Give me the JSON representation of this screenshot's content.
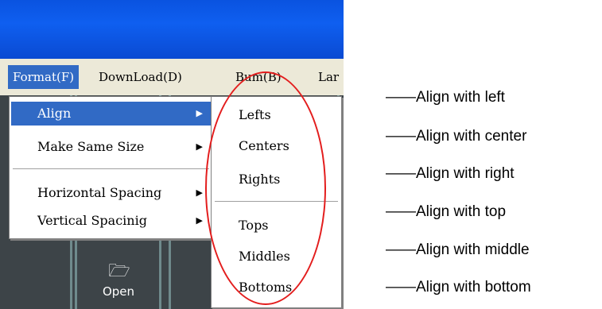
{
  "menubar": {
    "items": [
      {
        "label": "Format(F)"
      },
      {
        "label": "DownLoad(D)"
      },
      {
        "label": "Bum(B)"
      },
      {
        "label": "Lar"
      }
    ]
  },
  "format_menu": {
    "items": [
      {
        "label": "Align",
        "arrow": "▶"
      },
      {
        "label": "Make Same Size",
        "arrow": "▶"
      },
      {
        "label": "Horizontal Spacing",
        "arrow": "▶"
      },
      {
        "label": "Vertical Spacinig",
        "arrow": "▶"
      }
    ]
  },
  "align_submenu": {
    "items": [
      {
        "label": "Lefts"
      },
      {
        "label": "Centers"
      },
      {
        "label": "Rights"
      },
      {
        "label": "Tops"
      },
      {
        "label": "Middles"
      },
      {
        "label": "Bottoms"
      }
    ]
  },
  "toolbar": {
    "open_label": "Open",
    "open_icon": "folder-open-icon",
    "open_glyph": "🗁"
  },
  "annotations": [
    "——Align with left",
    "——Align with center",
    "——Align with right",
    "——Align with top",
    "——Align with middle",
    "——Align with bottom"
  ],
  "colors": {
    "title_bar": "#0a53e0",
    "highlight": "#316ac5",
    "oval": "#e31d1d"
  }
}
